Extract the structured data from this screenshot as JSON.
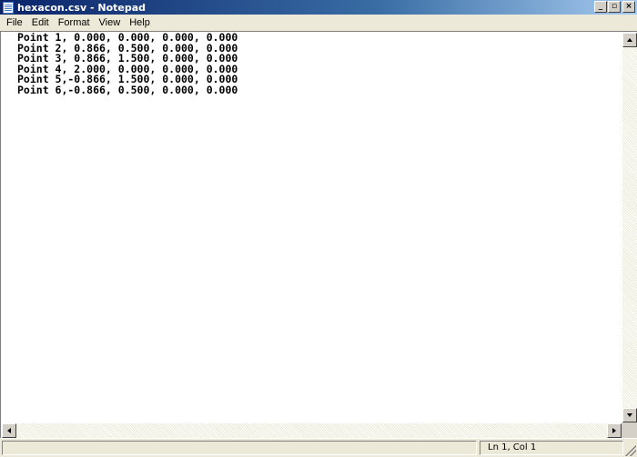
{
  "window": {
    "title": "hexacon.csv - Notepad",
    "buttons": {
      "minimize": "_",
      "maximize": "▫",
      "close": "×"
    }
  },
  "menu": {
    "items": [
      "File",
      "Edit",
      "Format",
      "View",
      "Help"
    ]
  },
  "document": {
    "lines": [
      "Point 1, 0.000, 0.000, 0.000, 0.000",
      "Point 2, 0.866, 0.500, 0.000, 0.000",
      "Point 3, 0.866, 1.500, 0.000, 0.000",
      "Point 4, 2.000, 0.000, 0.000, 0.000",
      "Point 5,-0.866, 1.500, 0.000, 0.000",
      "Point 6,-0.866, 0.500, 0.000, 0.000"
    ]
  },
  "status": {
    "position": "Ln 1, Col 1"
  },
  "colors": {
    "titlebar_start": "#0a246a",
    "titlebar_end": "#a6caf0",
    "chrome": "#ece9d8"
  }
}
